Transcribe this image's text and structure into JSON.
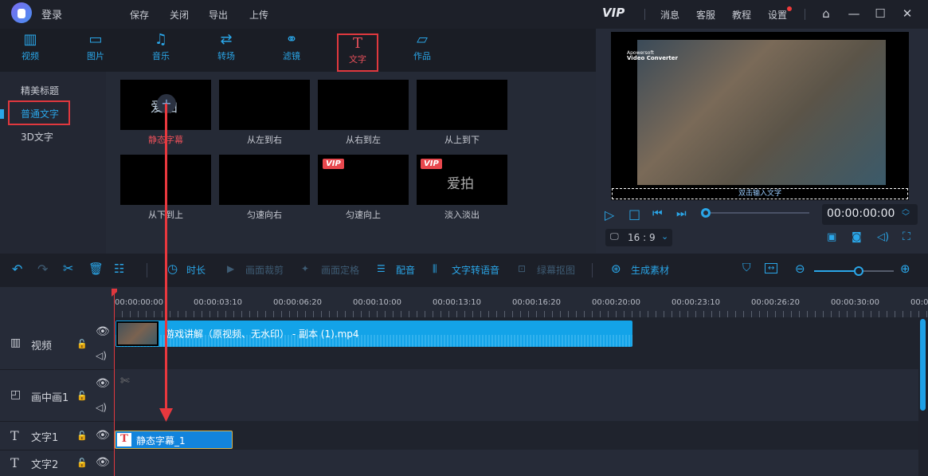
{
  "titlebar": {
    "login": "登录",
    "menu": [
      "保存",
      "关闭",
      "导出",
      "上传"
    ],
    "vip": "VIP",
    "right": [
      "消息",
      "客服",
      "教程",
      "设置"
    ]
  },
  "tabs": [
    {
      "label": "视频",
      "icon": "film-icon"
    },
    {
      "label": "图片",
      "icon": "image-icon"
    },
    {
      "label": "音乐",
      "icon": "music-icon"
    },
    {
      "label": "转场",
      "icon": "transition-icon"
    },
    {
      "label": "滤镜",
      "icon": "filter-icon"
    },
    {
      "label": "文字",
      "icon": "text-icon",
      "active": true
    },
    {
      "label": "作品",
      "icon": "folder-icon"
    }
  ],
  "sidebar": [
    "精美标题",
    "普通文字",
    "3D文字"
  ],
  "cards": [
    {
      "label": "静态字幕",
      "preview": "爱拍"
    },
    {
      "label": "从左到右"
    },
    {
      "label": "从右到左"
    },
    {
      "label": "从上到下"
    },
    {
      "label": "从下到上"
    },
    {
      "label": "匀速向右"
    },
    {
      "label": "匀速向上",
      "vip": "VIP"
    },
    {
      "label": "淡入淡出",
      "vip": "VIP",
      "preview": "爱拍"
    }
  ],
  "preview": {
    "watermark_brand": "Apowersoft",
    "watermark_product": "Video Converter",
    "text_placeholder": "双击输入文字",
    "timecode": "00:00:00:00",
    "ratio": "16 : 9",
    "progress": 0
  },
  "toolbar": [
    "时长",
    "画面裁剪",
    "画面定格",
    "配音",
    "文字转语音",
    "绿幕抠图",
    "生成素材"
  ],
  "ruler": [
    "00:00:00:00",
    "00:00:03:10",
    "00:00:06:20",
    "00:00:10:00",
    "00:00:13:10",
    "00:00:16:20",
    "00:00:20:00",
    "00:00:23:10",
    "00:00:26:20",
    "00:00:30:00",
    "00:0"
  ],
  "tracks": [
    {
      "label": "视频"
    },
    {
      "label": "画中画1"
    },
    {
      "label": "文字1"
    },
    {
      "label": "文字2"
    }
  ],
  "clips": {
    "video": "游戏讲解（原视频、无水印） - 副本 (1).mp4",
    "text": "静态字幕_1"
  },
  "colors": {
    "accent": "#2aa6e8",
    "highlight": "#e0383e"
  },
  "zoom_level": 0.65
}
